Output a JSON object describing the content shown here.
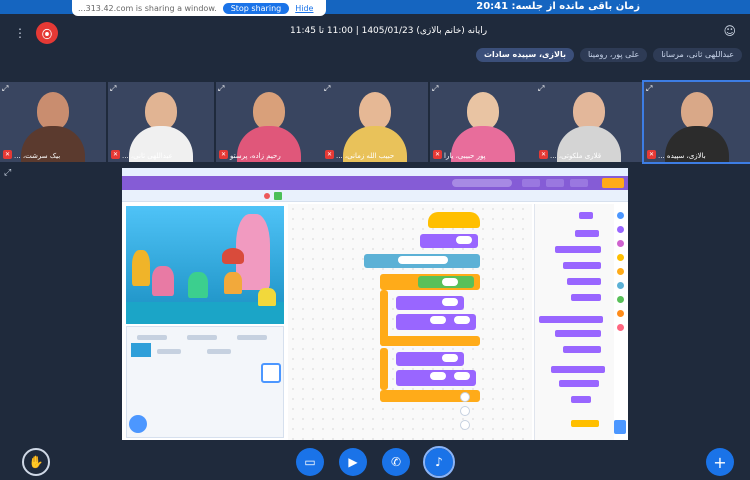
{
  "top": {
    "share_text": "...313.42.com is sharing a window.",
    "stop_label": "Stop sharing",
    "hide_label": "Hide",
    "timer_text": "زمان باقی مانده از جلسه: 20:41"
  },
  "header": {
    "session_info": "رایانه (خانم بالازی) 1405/01/23 | 11:00 تا 11:45",
    "rec_label": "●"
  },
  "chips": [
    {
      "label": "بالازی، سپیده سادات",
      "active": true
    },
    {
      "label": "علی پور، رومینا",
      "active": false
    },
    {
      "label": "عبداللهی ثانی، مرسانا",
      "active": false
    }
  ],
  "tiles": [
    {
      "name": "بیک سرشت، ...",
      "face": "#c98d6f",
      "body": "#5b3a2e"
    },
    {
      "name": "عبداللهی ثانی، ...",
      "face": "#e1b493",
      "body": "#f0f0f0"
    },
    {
      "name": "رحیم زاده، پرستو",
      "face": "#d9a07a",
      "body": "#e0577a"
    },
    {
      "name": "حبیب الله زمانی، ...",
      "face": "#e6b895",
      "body": "#e9c25a"
    },
    {
      "name": "پور حبیبی، یارا",
      "face": "#e9c4a3",
      "body": "#e86d9b"
    },
    {
      "name": "قلاری ملکوتی، ...",
      "face": "#e3b79a",
      "body": "#d4d4d4"
    },
    {
      "name": "بالازی، سپیده ...",
      "face": "#d9a888",
      "body": "#2c2c2c"
    }
  ],
  "colors": {
    "bg": "#1f2a3c",
    "accent": "#1a73e8",
    "scratch_purple": "#855cd6",
    "mute_red": "#e53935"
  }
}
